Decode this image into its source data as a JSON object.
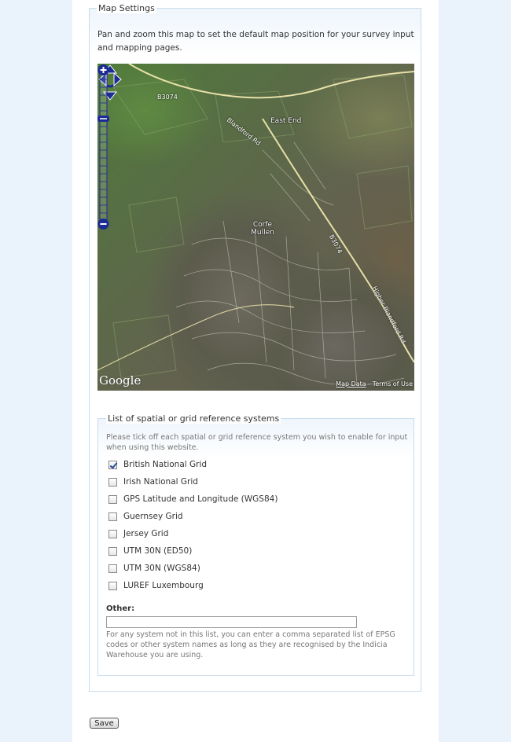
{
  "map_settings": {
    "legend": "Map Settings",
    "description": "Pan and zoom this map to set the default map position for your survey input and mapping pages.",
    "map": {
      "places": [
        "East End",
        "Corfe Mullen"
      ],
      "roads": [
        "B3074",
        "Blandford Rd",
        "B3074",
        "Higher Blandford Rd"
      ],
      "google_logo": "Google",
      "attribution_link": "Map Data",
      "attribution_sep": " - ",
      "attribution_terms": "Terms of Use"
    }
  },
  "grid_systems": {
    "legend": "List of spatial or grid reference systems",
    "hint": "Please tick off each spatial or grid reference system you wish to enable for input when using this website.",
    "options": [
      {
        "label": "British National Grid",
        "checked": true
      },
      {
        "label": "Irish National Grid",
        "checked": false
      },
      {
        "label": "GPS Latitude and Longitude (WGS84)",
        "checked": false
      },
      {
        "label": "Guernsey Grid",
        "checked": false
      },
      {
        "label": "Jersey Grid",
        "checked": false
      },
      {
        "label": "UTM 30N (ED50)",
        "checked": false
      },
      {
        "label": "UTM 30N (WGS84)",
        "checked": false
      },
      {
        "label": "LUREF Luxembourg",
        "checked": false
      }
    ],
    "other_label": "Other:",
    "other_value": "",
    "other_hint": "For any system not in this list, you can enter a comma separated list of EPSG codes or other system names as long as they are recognised by the Indicia Warehouse you are using."
  },
  "save_label": "Save",
  "colors": {
    "page_bg": "#eaf2fb",
    "border": "#c9dcec",
    "map_controls": "#1c2c94"
  }
}
